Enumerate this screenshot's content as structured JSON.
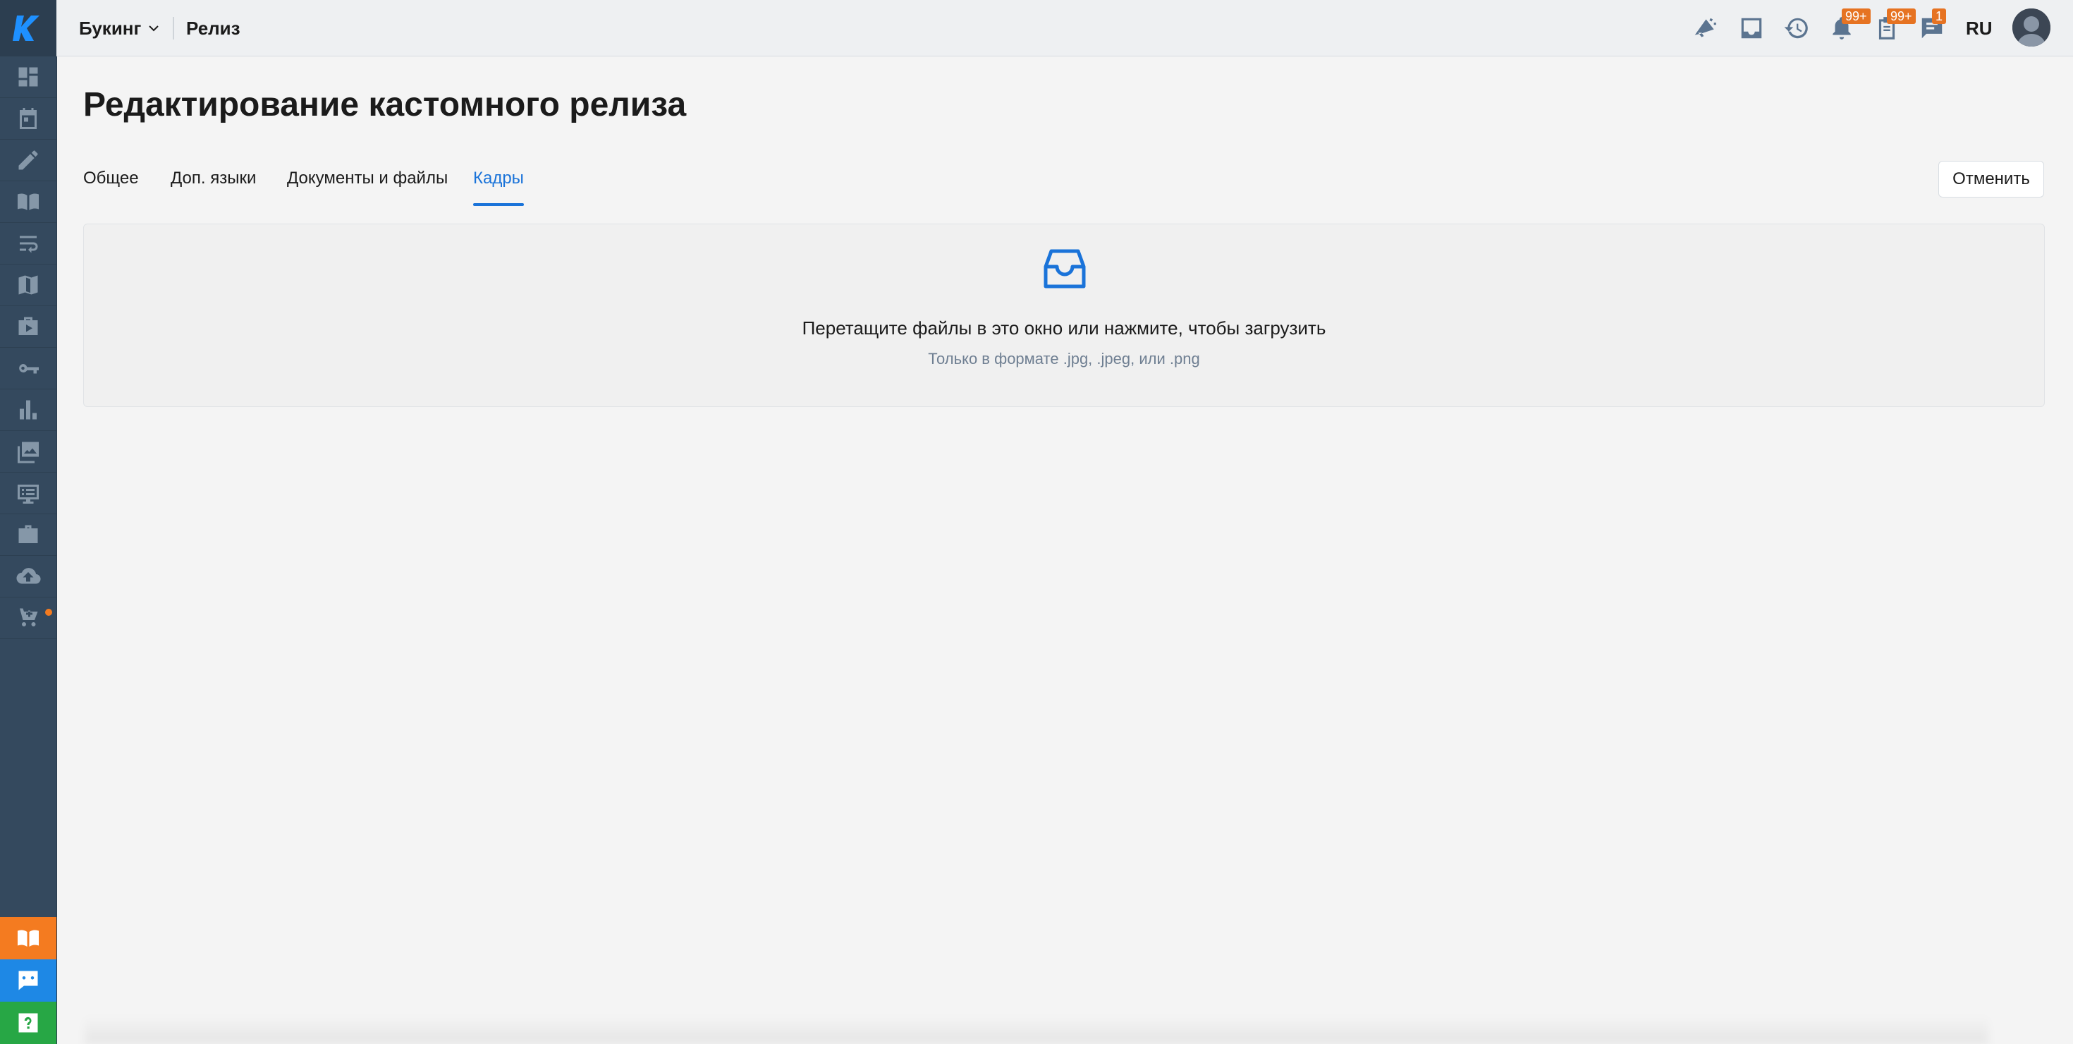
{
  "topbar": {
    "project": "Букинг",
    "crumb": "Релиз",
    "notifications_badge": "99+",
    "tasks_badge": "99+",
    "messages_badge": "1",
    "lang": "RU",
    "icons": [
      "megaphone-icon",
      "inbox-icon",
      "history-icon",
      "bell-icon",
      "clipboard-icon",
      "chat-icon"
    ]
  },
  "sidebar": {
    "logo": "K",
    "items": [
      "dashboard-icon",
      "calendar-icon",
      "pencil-icon",
      "book-icon",
      "wrap-icon",
      "map-icon",
      "media-icon",
      "key-icon",
      "chart-icon",
      "photos-icon",
      "list-icon",
      "briefcase-icon",
      "upload-icon",
      "cart-icon"
    ],
    "bottom": [
      "book-icon",
      "support-chat-icon",
      "help-icon"
    ],
    "colors": {
      "sidebar": "#34495e",
      "book": "#f47b20",
      "chat": "#1e88e5",
      "help": "#27a745"
    }
  },
  "page": {
    "title": "Редактирование кастомного релиза",
    "tabs": [
      {
        "label": "Общее",
        "active": false
      },
      {
        "label": "Доп. языки",
        "active": false
      },
      {
        "label": "Документы и файлы",
        "active": false
      },
      {
        "label": "Кадры",
        "active": true
      }
    ],
    "cancel_label": "Отменить",
    "dropzone": {
      "title": "Перетащите файлы в это окно или нажмите, чтобы загрузить",
      "hint": "Только в формате .jpg, .jpeg, или .png"
    },
    "accent": "#1a73d9"
  }
}
